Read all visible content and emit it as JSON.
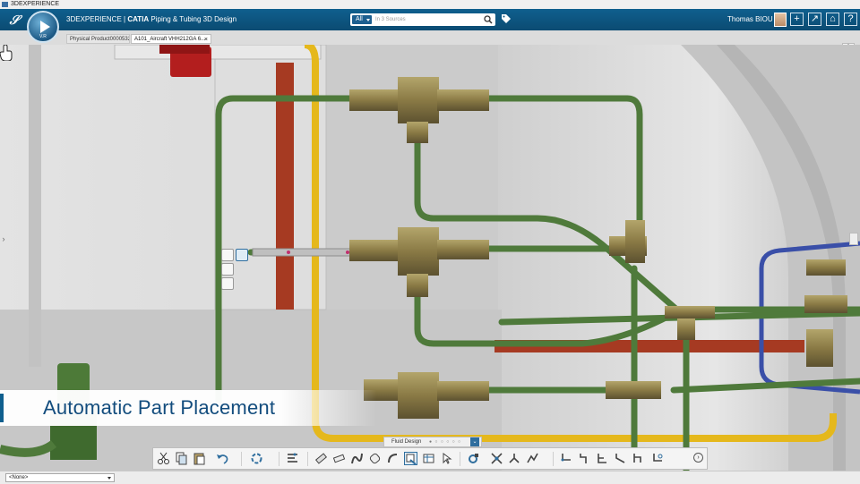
{
  "window": {
    "title": "3DEXPERIENCE"
  },
  "header": {
    "brand": "3DEXPERIENCE | ",
    "app_product": "CATIA",
    "app_name": " Piping & Tubing 3D Design",
    "search_scope": "All",
    "search_placeholder": "In 3 Sources",
    "user_name": "Thomas BIOU",
    "compass_version": "V.R"
  },
  "tabs": [
    {
      "label": "Physical Product00005323"
    },
    {
      "label": "A101_Aircraft VHH212GA 6...",
      "close": "×"
    }
  ],
  "viewport": {
    "banner_text": "Automatic Part Placement",
    "pipe_colors": {
      "green": "#4f7a3b",
      "yellow": "#e5b81c",
      "red": "#a63a22",
      "blue": "#3a4fa8",
      "fitting": "#8a7a45"
    }
  },
  "action_bar": {
    "section_label": "Fluid Design",
    "section_dots": "● ○ ○ ○ ○ ○",
    "chevron": "⌄",
    "more": "›",
    "icons": [
      "cut-icon",
      "copy-icon",
      "paste-icon",
      "undo-icon",
      "update-icon",
      "route-tree-icon",
      "part-placement-icon",
      "straight-pipe-icon",
      "bent-tube-icon",
      "flexible-hose-icon",
      "spool-icon",
      "place-part-icon",
      "catalog-icon",
      "select-cursor-icon",
      "connect-icon",
      "merge-icon",
      "split-icon",
      "spec-icon",
      "bend-icon",
      "offset-route-icon",
      "branch-icon",
      "slope-icon",
      "reroute-icon",
      "compass-route-icon"
    ]
  },
  "status": {
    "selection": "<None>"
  }
}
